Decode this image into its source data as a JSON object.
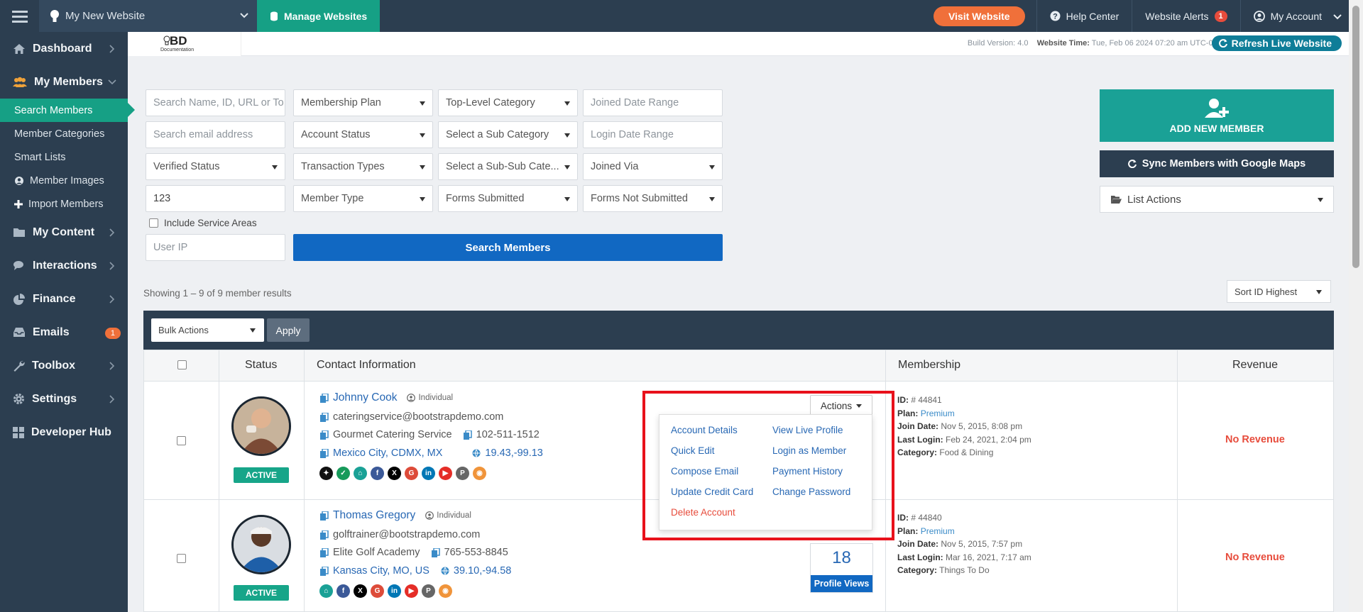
{
  "topbar": {
    "site_name": "My New Website",
    "manage_label": "Manage Websites",
    "visit_label": "Visit Website",
    "help_label": "Help Center",
    "alerts_label": "Website Alerts",
    "alerts_count": "1",
    "account_label": "My Account"
  },
  "sidebar": {
    "items": [
      {
        "label": "Dashboard",
        "icon": "home-icon"
      },
      {
        "label": "My Members",
        "icon": "users-icon"
      },
      {
        "label": "My Content",
        "icon": "folder-icon"
      },
      {
        "label": "Interactions",
        "icon": "chat-icon"
      },
      {
        "label": "Finance",
        "icon": "chart-icon"
      },
      {
        "label": "Emails",
        "icon": "inbox-icon",
        "badge": "1"
      },
      {
        "label": "Toolbox",
        "icon": "wrench-icon"
      },
      {
        "label": "Settings",
        "icon": "gear-icon"
      },
      {
        "label": "Developer Hub",
        "icon": "grid-icon"
      }
    ],
    "subitems": [
      {
        "label": "Search Members"
      },
      {
        "label": "Member Categories"
      },
      {
        "label": "Smart Lists"
      },
      {
        "label": "Member Images"
      },
      {
        "label": "Import Members"
      }
    ]
  },
  "subheader": {
    "logo_text": "BD",
    "logo_sub": "Documentation",
    "build_label": "Build Version:",
    "build_value": "4.0",
    "time_label": "Website Time:",
    "time_value": "Tue, Feb 06 2024 07:20 am UTC-08:00",
    "refresh_label": "Refresh Live Website"
  },
  "filters": {
    "search_name_placeholder": "Search Name, ID, URL or To",
    "membership_plan": "Membership Plan",
    "top_category": "Top-Level Category",
    "joined_range_placeholder": "Joined Date Range",
    "email_placeholder": "Search email address",
    "account_status": "Account Status",
    "sub_category": "Select a Sub Category",
    "login_range_placeholder": "Login Date Range",
    "verified_status": "Verified Status",
    "transaction_types": "Transaction Types",
    "subsub_category": "Select a Sub-Sub Cate...",
    "joined_via": "Joined Via",
    "zip_value": "123",
    "member_type": "Member Type",
    "forms_submitted": "Forms Submitted",
    "forms_not_submitted": "Forms Not Submitted",
    "include_service": "Include Service Areas",
    "user_ip_placeholder": "User IP",
    "search_button": "Search Members"
  },
  "right_actions": {
    "add_member": "ADD NEW MEMBER",
    "sync": "Sync Members with Google Maps",
    "list_actions": "List Actions"
  },
  "results": {
    "showing": "Showing 1 – 9 of 9 member results",
    "sort": "Sort ID Highest",
    "bulk": "Bulk Actions",
    "apply": "Apply"
  },
  "table": {
    "headers": {
      "status": "Status",
      "contact": "Contact Information",
      "membership": "Membership",
      "revenue": "Revenue"
    },
    "rows": [
      {
        "name": "Johnny Cook",
        "type": "Individual",
        "email": "cateringservice@bootstrapdemo.com",
        "company": "Gourmet Catering Service",
        "phone": "102-511-1512",
        "location": "Mexico City, CDMX, MX",
        "coords": "19.43,-99.13",
        "status": "ACTIVE",
        "id_label": "ID:",
        "id": "# 44841",
        "plan_label": "Plan:",
        "plan": "Premium",
        "join_label": "Join Date:",
        "join": "Nov 5, 2015, 8:08 pm",
        "login_label": "Last Login:",
        "login": "Feb 24, 2021, 2:04 pm",
        "cat_label": "Category:",
        "category": "Food & Dining",
        "revenue": "No Revenue",
        "actions": "Actions"
      },
      {
        "name": "Thomas Gregory",
        "type": "Individual",
        "email": "golftrainer@bootstrapdemo.com",
        "company": "Elite Golf Academy",
        "phone": "765-553-8845",
        "location": "Kansas City, MO, US",
        "coords": "39.10,-94.58",
        "status": "ACTIVE",
        "id_label": "ID:",
        "id": "# 44840",
        "plan_label": "Plan:",
        "plan": "Premium",
        "join_label": "Join Date:",
        "join": "Nov 5, 2015, 7:57 pm",
        "login_label": "Last Login:",
        "login": "Mar 16, 2021, 7:17 am",
        "cat_label": "Category:",
        "category": "Things To Do",
        "revenue": "No Revenue",
        "views": "18",
        "views_label": "Profile Views"
      }
    ]
  },
  "actions_menu": {
    "account_details": "Account Details",
    "view_profile": "View Live Profile",
    "quick_edit": "Quick Edit",
    "login_as": "Login as Member",
    "compose_email": "Compose Email",
    "payment_history": "Payment History",
    "update_card": "Update Credit Card",
    "change_password": "Change Password",
    "delete_account": "Delete Account"
  },
  "colors": {
    "accent": "#16a085",
    "primary": "#1168c2",
    "dark": "#2c3e50",
    "highlight": "#e8111b"
  }
}
